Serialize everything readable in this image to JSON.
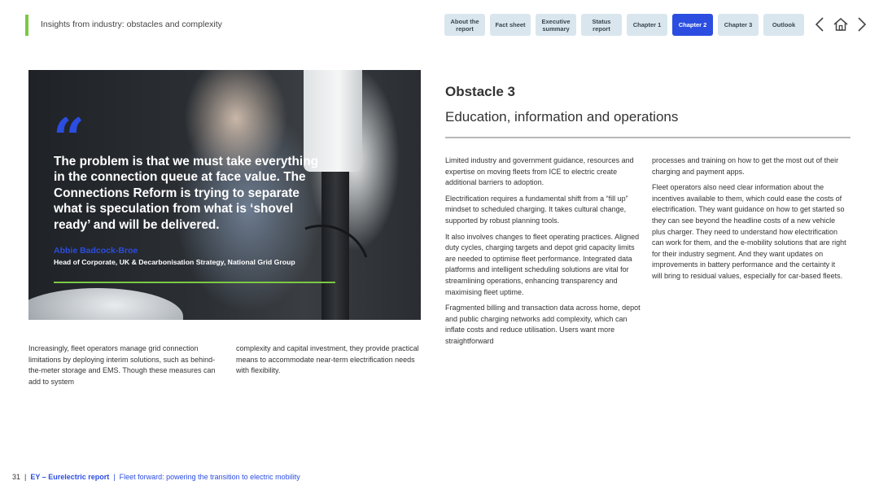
{
  "header": {
    "title": "Insights from industry: obstacles and complexity"
  },
  "nav": {
    "about": "About the report",
    "fact_sheet": "Fact sheet",
    "exec_summary": "Executive summary",
    "status_report": "Status report",
    "chapter1": "Chapter 1",
    "chapter2": "Chapter 2",
    "chapter3": "Chapter 3",
    "outlook": "Outlook"
  },
  "quote": {
    "mark": "“",
    "text": "The problem is that we must take everything in the connection queue at face value. The Connections Reform is trying to separate what is speculation from what is ‘shovel ready’ and will be delivered.",
    "author": "Abbie Badcock-Broe",
    "role": "Head of Corporate, UK & Decarbonisation Strategy, National Grid Group"
  },
  "left_text": {
    "col1": "Increasingly, fleet operators manage grid connection limitations by deploying interim solutions, such as behind-the-meter storage and EMS. Though these measures can add to system",
    "col2": "complexity and capital investment, they provide practical means to accommodate near-term electrification needs with flexibility."
  },
  "section": {
    "obstacle": "Obstacle 3",
    "title": "Education, information and operations"
  },
  "col1": {
    "p1": "Limited industry and government guidance, resources and expertise on moving fleets from ICE to electric create additional barriers to adoption.",
    "p2": "Electrification requires a fundamental shift from a “fill up” mindset to scheduled charging. It takes cultural change, supported by robust planning tools.",
    "p3": "It also involves changes to fleet operating practices. Aligned duty cycles, charging targets and depot grid capacity limits are needed to optimise fleet performance. Integrated data platforms and intelligent scheduling solutions are vital for streamlining operations, enhancing transparency and maximising fleet uptime.",
    "p4": "Fragmented billing and transaction data across home, depot and public charging networks add complexity, which can inflate costs and reduce utilisation. Users want more straightforward"
  },
  "col2": {
    "p1": "processes and training on how to get the most out of their charging and payment apps.",
    "p2": "Fleet operators also need clear information about the incentives available to them, which could ease the costs of electrification. They want guidance on how to get started so they can see beyond the headline costs of a new vehicle plus charger. They need to understand how electrification can work for them, and the e-mobility solutions that are right for their industry segment. And they want updates on improvements in battery performance and the certainty it will bring to residual values, especially for car-based fleets."
  },
  "footer": {
    "page": "31",
    "sep1": "|",
    "brand": "EY – Eurelectric report",
    "sep2": "|",
    "subtitle": "Fleet forward: powering the transition to electric mobility"
  },
  "colors": {
    "accent_blue": "#2b4de0",
    "accent_green": "#7ac943",
    "nav_bg": "#d9e6ee"
  },
  "icons": [
    "chevron-left-icon",
    "home-icon",
    "chevron-right-icon"
  ]
}
